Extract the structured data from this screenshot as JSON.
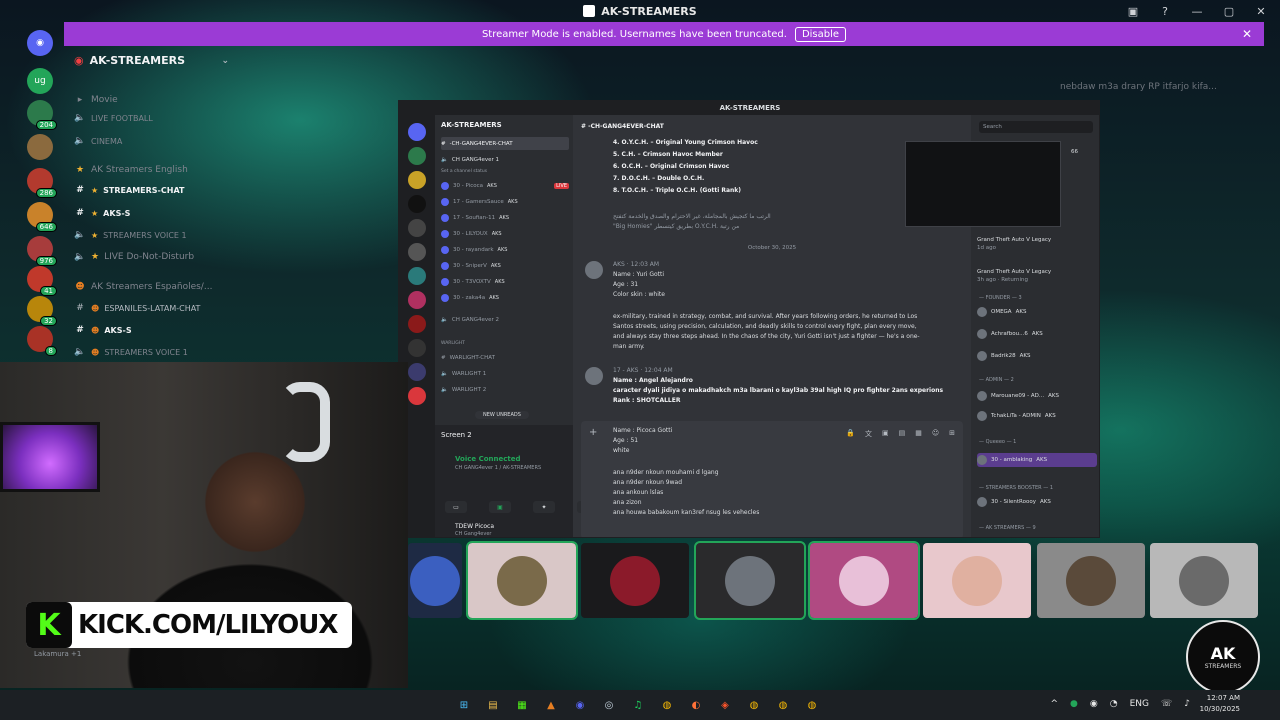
{
  "window": {
    "title": "AK-STREAMERS"
  },
  "banner": {
    "text": "Streamer Mode is enabled. Usernames have been truncated.",
    "disable_label": "Disable"
  },
  "rail": {
    "home_label": "",
    "ug_label": "ug",
    "badges": [
      "204",
      "286",
      "646",
      "976",
      "41",
      "32",
      "8"
    ]
  },
  "sidebar": {
    "guild": "AK-STREAMERS",
    "rows": [
      {
        "label": "Movie",
        "kind": "category"
      },
      {
        "label": "LIVE FOOTBALL",
        "kind": "voice"
      },
      {
        "label": "CINEMA",
        "kind": "voice"
      },
      {
        "label": "AK Streamers English",
        "kind": "category"
      },
      {
        "label": "STREAMERS-CHAT",
        "kind": "text-active"
      },
      {
        "label": "AKS-S",
        "kind": "text-active"
      },
      {
        "label": "STREAMERS VOICE 1",
        "kind": "voice"
      },
      {
        "label": "LIVE Do-Not-Disturb",
        "kind": "voice"
      },
      {
        "label": "AK Streamers Españoles/...",
        "kind": "category"
      },
      {
        "label": "ESPANILES-LATAM-CHAT",
        "kind": "text"
      },
      {
        "label": "AKS-S",
        "kind": "text-active"
      },
      {
        "label": "STREAMERS VOICE 1",
        "kind": "voice"
      }
    ]
  },
  "ghost_message": "nebdaw m3a drary RP itfarjo kifa...",
  "inner": {
    "title": "AK-STREAMERS",
    "guild": "AK-STREAMERS",
    "channel": "-CH-GANG4EVER-CHAT",
    "rows": [
      {
        "label": "-CH-GANG4EVER-CHAT",
        "sel": true
      },
      {
        "label": "CH GANG4ever 1"
      },
      {
        "label": "Set a channel status"
      },
      {
        "label": "30 - Picoca",
        "tag": "AKS",
        "live": "LIVE"
      },
      {
        "label": "17 - GamersSauce",
        "tag": "AKS"
      },
      {
        "label": "17 - Soufian-11",
        "tag": "AKS"
      },
      {
        "label": "30 - LILYOUX",
        "tag": "AKS"
      },
      {
        "label": "30 - rayandark",
        "tag": "AKS"
      },
      {
        "label": "30 - SniperV",
        "tag": "AKS"
      },
      {
        "label": "30 - T3VOXTV",
        "tag": "AKS"
      },
      {
        "label": "30 - zaka4a",
        "tag": "AKS"
      },
      {
        "label": "CH GANG4ever 2"
      },
      {
        "label": "WARLIGHT"
      },
      {
        "label": "WARLIGHT-CHAT"
      },
      {
        "label": "WARLIGHT 1"
      },
      {
        "label": "WARLIGHT 2"
      }
    ],
    "new_unreads": "NEW UNREADS",
    "voice": {
      "screen": "Screen 2",
      "connected": "Voice Connected",
      "connected_sub": "CH GANG4ever 1 / AK-STREAMERS",
      "user": "TDEW Picoca",
      "user_sub": "CH Gang4ever"
    }
  },
  "chat": {
    "rank_lines": [
      "4. O.Y.C.H. – Original Young Crimson Havoc",
      "5. C.H. – Crimson Havoc Member",
      "6. O.C.H. – Original Crimson Havoc",
      "7. D.O.C.H. – Double O.C.H.",
      "8. T.O.C.H. – Triple O.C.H. (Gotti Rank)"
    ],
    "arabic_1": "الرتب ما كتجيش بالمجاملة، غير الاحترام والصدق والخدمة كتفتح",
    "arabic_2": "\"Big Homies\" بطريق كيتسطر O.Y.C.H. من رتبة",
    "date": "October 30, 2025",
    "msg1": {
      "time": "12:03 AM",
      "tag": "AKS",
      "lines": [
        "Name : Yuri Gotti",
        "Age : 31",
        "Color skin : white"
      ],
      "para": [
        "ex-military, trained in strategy, combat, and survival. After years following orders, he returned to Los",
        "Santos streets, using precision, calculation, and deadly skills to control every fight, plan every move,",
        "and always stay three steps ahead. In the chaos of the city, Yuri Gotti isn't just a fighter — he's a one-",
        "man army."
      ]
    },
    "msg2": {
      "author": "17 -",
      "tag": "AKS",
      "time": "12:04 AM",
      "lines": [
        "Name : Angel Alejandro",
        "caracter dyali jidiya o makadhakch m3a lbarani o kayl3ab 39al high IQ pro fighter 2ans experions",
        "Rank : SHOTCALLER"
      ]
    },
    "composer": [
      "Name : Picoca Gotti",
      "Age : 51",
      "white",
      "",
      "ana n9der nkoun mouhami d lgang",
      "ana n9der nkoun 9wad",
      "ana ankoun lslas",
      "ana zizon",
      "ana houwa babakoum kan3ref nsug les vehecles"
    ]
  },
  "members": {
    "search_placeholder": "Search",
    "count_66": "66",
    "activities": [
      {
        "name": "Grand Theft Auto V Legacy",
        "sub": "1d ago"
      },
      {
        "name": "Grand Theft Auto V Legacy",
        "sub": "3h ago · Returning"
      }
    ],
    "roles": [
      {
        "header": "— FOUNDER — 3",
        "items": [
          {
            "name": "OMEGA",
            "sub": "Sharing their screen",
            "tag": "AKS"
          },
          {
            "name": "Achrafbou...6",
            "sub": "FiveM +1",
            "tag": "AKS"
          },
          {
            "name": "Badrik28",
            "sub": "In voice",
            "tag": "AKS"
          }
        ]
      },
      {
        "header": "— ADMIN — 2",
        "items": [
          {
            "name": "Marouane09 - AD...",
            "sub": "In voice",
            "tag": "AKS"
          },
          {
            "name": "TchakLiTa - ADMIN",
            "sub": "kick_TchakLiTa",
            "tag": "AKS"
          }
        ]
      },
      {
        "header": "— Queeeo — 1",
        "items": [
          {
            "name": "30 - amblaking",
            "sub": "Kick : amblaking",
            "tag": "AKS"
          }
        ]
      },
      {
        "header": "— STREAMERS BOOSTER — 1",
        "items": [
          {
            "name": "30 - SilentRoooy",
            "sub": "On rock Blasty",
            "tag": "AKS"
          }
        ]
      },
      {
        "header": "— AK STREAMERS — 9",
        "items": []
      }
    ]
  },
  "kick": {
    "logo": "K",
    "url": "KICK.COM/LILYOUX"
  },
  "lakamura": "Lakamura +1",
  "badge_logo": {
    "main": "AK",
    "sub": "STREAMERS"
  },
  "taskbar": {
    "apps": [
      "⊞",
      "▤",
      "▦",
      "▲",
      "◉",
      "◎",
      "♫",
      "◍",
      "◐",
      "◈",
      "◍",
      "◍",
      "◍"
    ],
    "tray": [
      "^",
      "●",
      "◉",
      "◔",
      "ENG",
      "☏",
      "♪"
    ],
    "time": "12:07 AM",
    "date": "10/30/2025"
  },
  "colors": {
    "accent": "#9b3bd5",
    "online": "#23a559",
    "kick_green": "#53fc18"
  }
}
